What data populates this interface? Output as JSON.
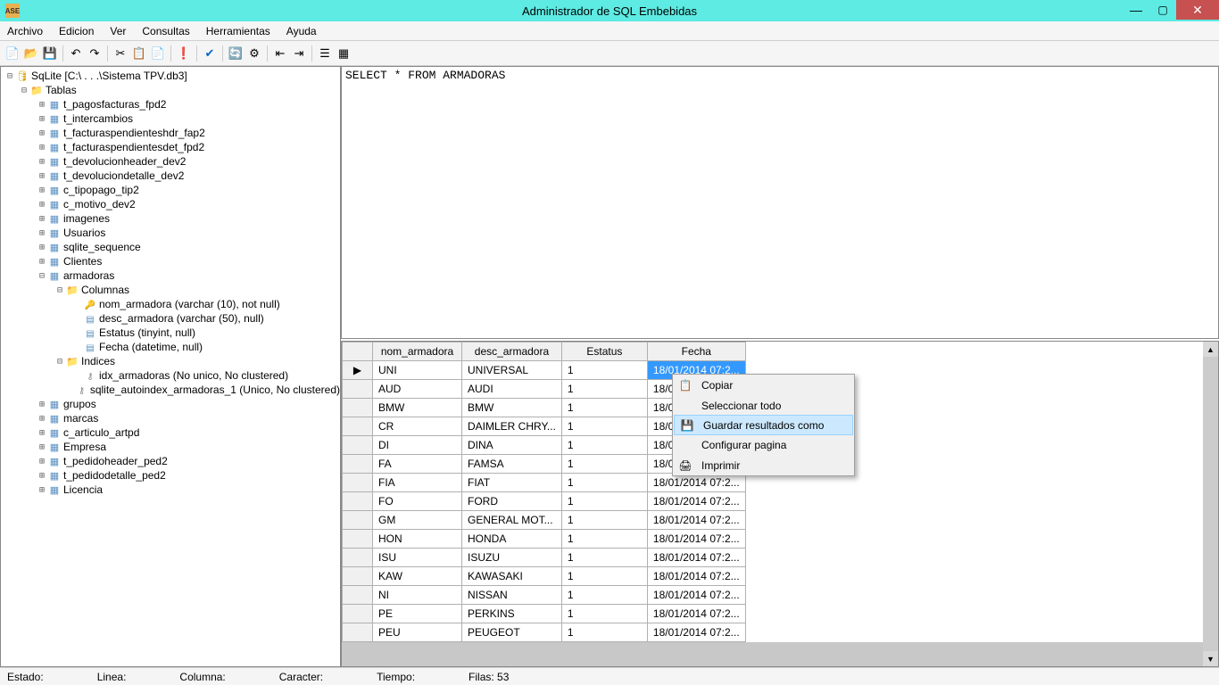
{
  "window": {
    "title": "Administrador de SQL Embebidas"
  },
  "menu": {
    "archivo": "Archivo",
    "edicion": "Edicion",
    "ver": "Ver",
    "consultas": "Consultas",
    "herramientas": "Herramientas",
    "ayuda": "Ayuda"
  },
  "tree": {
    "root": "SqLite [C:\\ . . .\\Sistema TPV.db3]",
    "tablas": "Tablas",
    "tables": [
      "t_pagosfacturas_fpd2",
      "t_intercambios",
      "t_facturaspendienteshdr_fap2",
      "t_facturaspendientesdet_fpd2",
      "t_devolucionheader_dev2",
      "t_devoluciondetalle_dev2",
      "c_tipopago_tip2",
      "c_motivo_dev2",
      "imagenes",
      "Usuarios",
      "sqlite_sequence",
      "Clientes"
    ],
    "armadoras": "armadoras",
    "columnas": "Columnas",
    "cols": [
      "nom_armadora (varchar (10), not null)",
      "desc_armadora (varchar (50), null)",
      "Estatus (tinyint, null)",
      "Fecha (datetime, null)"
    ],
    "indices": "Indices",
    "idx": [
      "idx_armadoras (No unico, No clustered)",
      "sqlite_autoindex_armadoras_1 (Unico, No clustered)"
    ],
    "after": [
      "grupos",
      "marcas",
      "c_articulo_artpd",
      "Empresa",
      "t_pedidoheader_ped2",
      "t_pedidodetalle_ped2",
      "Licencia"
    ]
  },
  "sql": "SELECT * FROM ARMADORAS",
  "grid": {
    "headers": [
      "nom_armadora",
      "desc_armadora",
      "Estatus",
      "Fecha"
    ],
    "rows": [
      [
        "UNI",
        "UNIVERSAL",
        "1",
        "18/01/2014 07:2..."
      ],
      [
        "AUD",
        "AUDI",
        "1",
        "18/0"
      ],
      [
        "BMW",
        "BMW",
        "1",
        "18/0"
      ],
      [
        "CR",
        "DAIMLER CHRY...",
        "1",
        "18/0"
      ],
      [
        "DI",
        "DINA",
        "1",
        "18/0"
      ],
      [
        "FA",
        "FAMSA",
        "1",
        "18/0"
      ],
      [
        "FIA",
        "FIAT",
        "1",
        "18/01/2014 07:2..."
      ],
      [
        "FO",
        "FORD",
        "1",
        "18/01/2014 07:2..."
      ],
      [
        "GM",
        "GENERAL MOT...",
        "1",
        "18/01/2014 07:2..."
      ],
      [
        "HON",
        "HONDA",
        "1",
        "18/01/2014 07:2..."
      ],
      [
        "ISU",
        "ISUZU",
        "1",
        "18/01/2014 07:2..."
      ],
      [
        "KAW",
        "KAWASAKI",
        "1",
        "18/01/2014 07:2..."
      ],
      [
        "NI",
        "NISSAN",
        "1",
        "18/01/2014 07:2..."
      ],
      [
        "PE",
        "PERKINS",
        "1",
        "18/01/2014 07:2..."
      ],
      [
        "PEU",
        "PEUGEOT",
        "1",
        "18/01/2014 07:2..."
      ]
    ]
  },
  "ctx": {
    "copiar": "Copiar",
    "seleccionar": "Seleccionar todo",
    "guardar": "Guardar resultados como",
    "configurar": "Configurar pagina",
    "imprimir": "Imprimir"
  },
  "status": {
    "estado": "Estado:",
    "linea": "Linea:",
    "columna": "Columna:",
    "caracter": "Caracter:",
    "tiempo": "Tiempo:",
    "filas": "Filas: 53"
  }
}
